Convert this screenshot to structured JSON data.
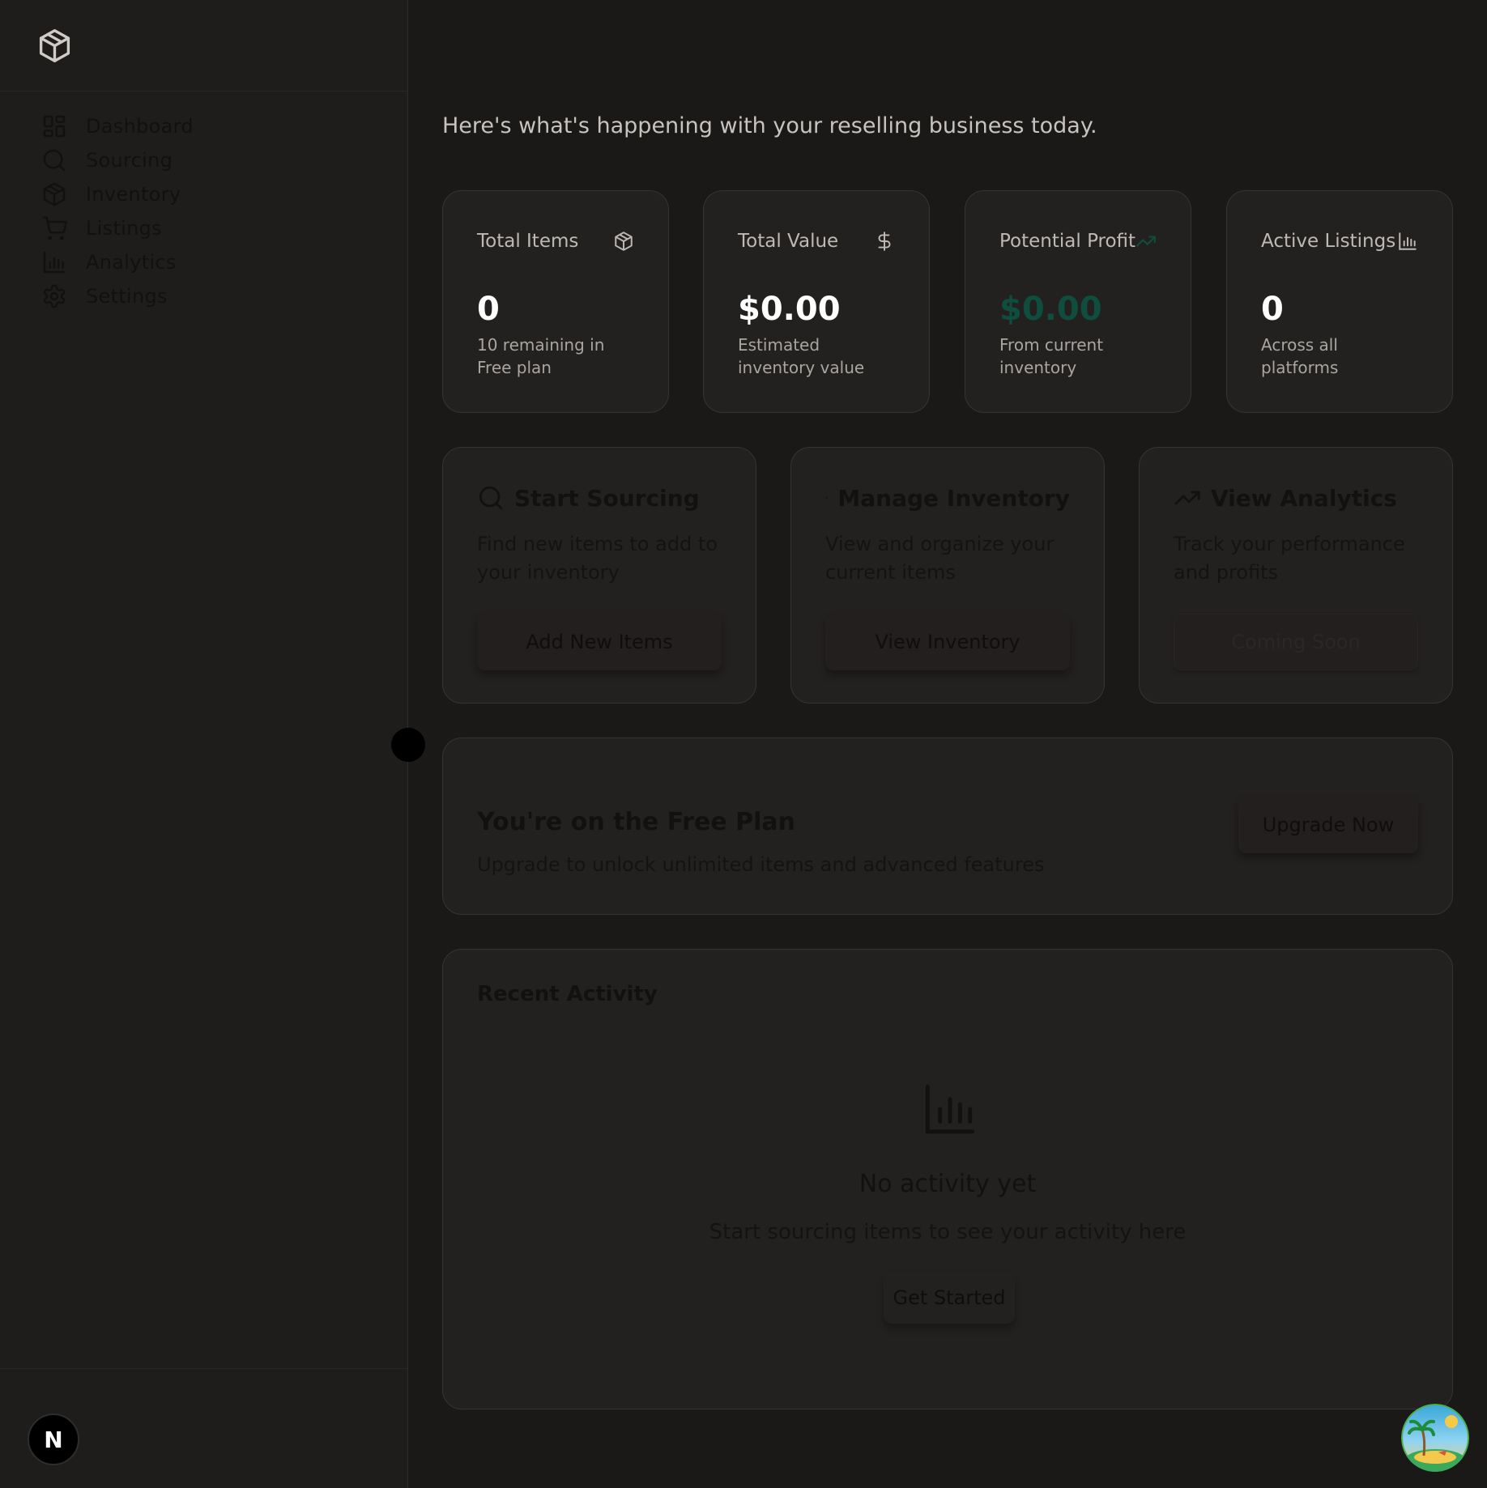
{
  "sidebar": {
    "logo_icon": "package-icon",
    "items": [
      {
        "label": "Dashboard",
        "icon": "layout-grid-icon"
      },
      {
        "label": "Sourcing",
        "icon": "search-icon"
      },
      {
        "label": "Inventory",
        "icon": "package-icon"
      },
      {
        "label": "Listings",
        "icon": "shopping-cart-icon"
      },
      {
        "label": "Analytics",
        "icon": "bar-chart-icon"
      },
      {
        "label": "Settings",
        "icon": "gear-icon"
      }
    ],
    "avatar_letter": "N"
  },
  "header": {
    "subtitle": "Here's what's happening with your reselling business today."
  },
  "stats": [
    {
      "title": "Total Items",
      "value": "0",
      "note": "10 remaining in Free plan",
      "icon": "package-icon"
    },
    {
      "title": "Total Value",
      "value": "$0.00",
      "note": "Estimated inventory value",
      "icon": "dollar-icon"
    },
    {
      "title": "Potential Profit",
      "value": "$0.00",
      "note": "From current inventory",
      "icon": "trending-up-icon",
      "accent": "#0f4d3e"
    },
    {
      "title": "Active Listings",
      "value": "0",
      "note": "Across all platforms",
      "icon": "bar-chart-icon"
    }
  ],
  "actions": [
    {
      "title": "Start Sourcing",
      "desc": "Find new items to add to your inventory",
      "button": "Add New Items",
      "icon": "search-icon"
    },
    {
      "title": "Manage Inventory",
      "desc": "View and organize your current items",
      "button": "View Inventory",
      "icon": "package-icon"
    },
    {
      "title": "View Analytics",
      "desc": "Track your performance and profits",
      "button": "Coming Soon",
      "icon": "trending-up-icon",
      "disabled": true
    }
  ],
  "plan": {
    "title": "You're on the Free Plan",
    "desc": "Upgrade to unlock unlimited items and advanced features",
    "button": "Upgrade Now"
  },
  "recent": {
    "title": "Recent Activity",
    "empty_title": "No activity yet",
    "empty_desc": "Start sourcing items to see your activity here",
    "button": "Get Started",
    "icon": "bar-chart-icon"
  },
  "colors": {
    "background": "#1b1918",
    "card": "#232120",
    "profit_accent": "#0f4d3e"
  }
}
